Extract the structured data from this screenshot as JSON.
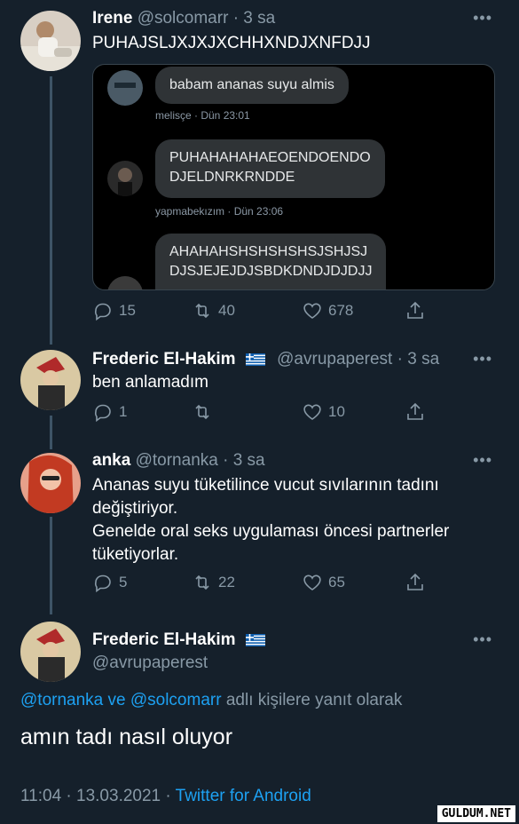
{
  "tweet1": {
    "name": "Irene",
    "handle": "@solcomarr",
    "time": "· 3 sa",
    "more": "•••",
    "text": "PUHAJSLJXJXJXCHHXNDJXNFDJJ",
    "embed": {
      "msg1": "babam ananas suyu almis",
      "meta1": "melisçe · Dün 23:01",
      "msg2_line1": "PUHAHAHAHAEOENDOENDO",
      "msg2_line2": "DJELDNRKRNDDE",
      "meta2": "yapmabekızım · Dün 23:06",
      "msg3_line1": "AHAHAHSHSHSHSHSJSHJSJ",
      "msg3_line2": "DJSJEJEJDJSBDKDNDJDJDJJ"
    },
    "replies": "15",
    "retweets": "40",
    "likes": "678"
  },
  "tweet2": {
    "name": "Frederic El-Hakim",
    "handle": "@avrupaperest",
    "time": "· 3 sa",
    "more": "•••",
    "text": "ben anlamadım",
    "replies": "1",
    "retweets": "",
    "likes": "10"
  },
  "tweet3": {
    "name": "anka",
    "handle": "@tornanka",
    "time": "· 3 sa",
    "more": "•••",
    "text_line1": "Ananas suyu tüketilince vucut sıvılarının tadını",
    "text_line2": "değiştiriyor.",
    "text_line3": "Genelde oral seks uygulaması öncesi partnerler",
    "text_line4": "tüketiyorlar.",
    "replies": "5",
    "retweets": "22",
    "likes": "65"
  },
  "main": {
    "name": "Frederic El-Hakim",
    "handle": "@avrupaperest",
    "more": "•••",
    "reply_to_user1": "@tornanka",
    "reply_to_and": " ve ",
    "reply_to_user2": "@solcomarr",
    "reply_to_suffix": " adlı kişilere yanıt olarak",
    "text": "amın tadı nasıl oluyor",
    "timestamp": "11:04 · 13.03.2021 · ",
    "source": "Twitter for Android"
  },
  "watermark": "GULDUM.NET",
  "colors": {
    "background": "#15202b",
    "secondary_text": "#8899a6",
    "link": "#1da1f2"
  }
}
